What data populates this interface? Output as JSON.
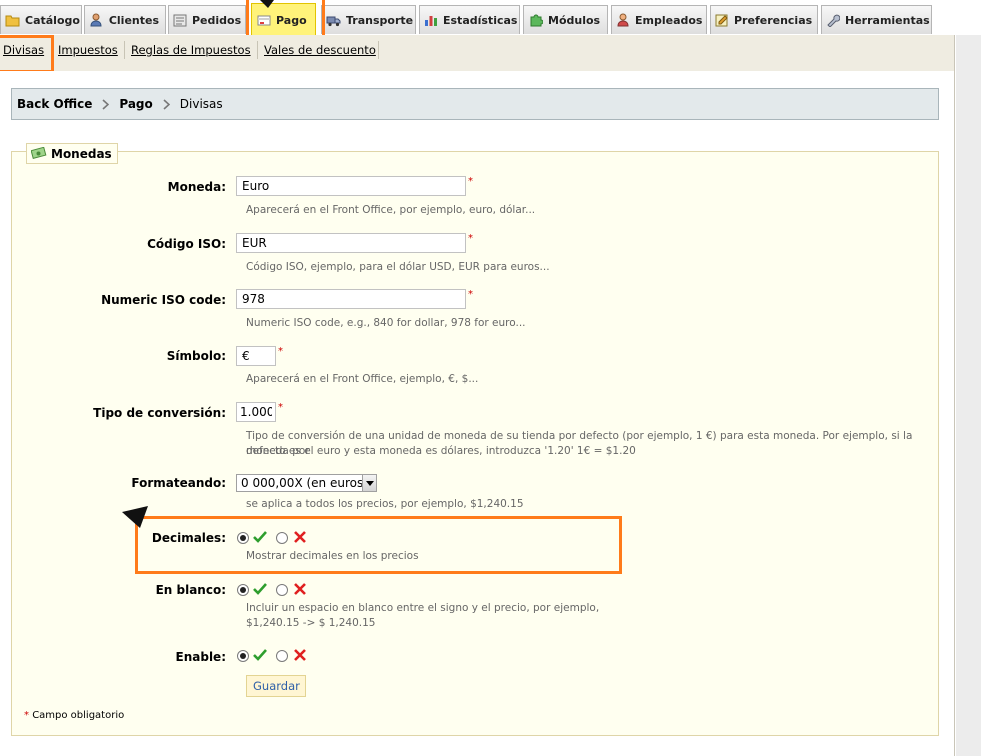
{
  "tabs": [
    {
      "label": "Catálogo",
      "icon": "folder-icon"
    },
    {
      "label": "Clientes",
      "icon": "user-icon"
    },
    {
      "label": "Pedidos",
      "icon": "orders-icon"
    },
    {
      "label": "Pago",
      "icon": "payment-icon",
      "active": true
    },
    {
      "label": "Transporte",
      "icon": "truck-icon"
    },
    {
      "label": "Estadísticas",
      "icon": "chart-icon"
    },
    {
      "label": "Módulos",
      "icon": "puzzle-icon"
    },
    {
      "label": "Empleados",
      "icon": "employee-icon"
    },
    {
      "label": "Preferencias",
      "icon": "preferences-icon"
    },
    {
      "label": "Herramientas",
      "icon": "wrench-icon"
    }
  ],
  "submenu": [
    "Divisas",
    "Impuestos",
    "Reglas de Impuestos",
    "Vales de descuento"
  ],
  "breadcrumb": {
    "root": "Back Office",
    "section": "Pago",
    "current": "Divisas"
  },
  "form": {
    "legend": "Monedas",
    "currency": {
      "label": "Moneda:",
      "value": "Euro",
      "hint": "Aparecerá en el Front Office, por ejemplo, euro, dólar..."
    },
    "iso": {
      "label": "Código ISO:",
      "value": "EUR",
      "hint": "Código ISO, ejemplo, para el dólar USD, EUR para euros..."
    },
    "numeric_iso": {
      "label": "Numeric ISO code:",
      "value": "978",
      "hint": "Numeric ISO code, e.g., 840 for dollar, 978 for euro..."
    },
    "symbol": {
      "label": "Símbolo:",
      "value": "€",
      "hint": "Aparecerá en el Front Office, ejemplo, €, $..."
    },
    "conversion": {
      "label": "Tipo de conversión:",
      "value": "1.000",
      "hint_line1": "Tipo de conversión de una unidad de moneda de su tienda por defecto (por ejemplo, 1 €) para esta moneda. Por ejemplo, si la moneda por",
      "hint_line2": "defecto es el euro y esta moneda es dólares, introduzca '1.20' 1€ = $1.20"
    },
    "formatting": {
      "label": "Formateando:",
      "value": "0 000,00X (en euros)",
      "hint": "se aplica a todos los precios, por ejemplo, $1,240.15"
    },
    "decimals": {
      "label": "Decimales:",
      "hint": "Mostrar decimales en los precios",
      "selected": "yes"
    },
    "blank": {
      "label": "En blanco:",
      "hint_line1": "Incluir un espacio en blanco entre el signo y el precio, por ejemplo,",
      "hint_line2": "$1,240.15 -> $ 1,240.15",
      "selected": "yes"
    },
    "enable": {
      "label": "Enable:",
      "selected": "yes"
    },
    "save_label": "Guardar",
    "required_star": "*",
    "required_note": "Campo obligatorio"
  },
  "colors": {
    "yes": "#2e9e2e",
    "no": "#e02020",
    "highlight": "#ff7b1a"
  }
}
